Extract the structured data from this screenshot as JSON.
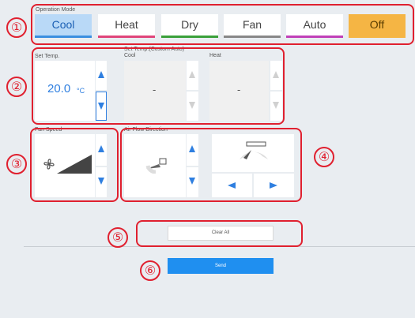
{
  "operation_mode": {
    "label": "Operation Mode",
    "modes": [
      {
        "label": "Cool",
        "underline": "#3b8fe0",
        "selected": true
      },
      {
        "label": "Heat",
        "underline": "#e0457a",
        "selected": false
      },
      {
        "label": "Dry",
        "underline": "#3aa03a",
        "selected": false
      },
      {
        "label": "Fan",
        "underline": "#888888",
        "selected": false
      },
      {
        "label": "Auto",
        "underline": "#c040b8",
        "selected": false
      },
      {
        "label": "Off",
        "underline": "#f5b544",
        "selected": false
      }
    ]
  },
  "set_temp": {
    "label": "Set Temp.",
    "value": "20.0",
    "unit": "°C",
    "custom_auto_label": "Set Temp.(Custom Auto)",
    "cool_label": "Cool",
    "cool_value": "-",
    "heat_label": "Heat",
    "heat_value": "-"
  },
  "fan_speed": {
    "label": "Fan Speed",
    "icon": "fan-icon"
  },
  "air_flow": {
    "label": "Air Flow Direction"
  },
  "actions": {
    "clear_all": "Clear All",
    "send": "Send"
  },
  "callouts": [
    "①",
    "②",
    "③",
    "④",
    "⑤",
    "⑥"
  ],
  "colors": {
    "accent": "#2f7fe0",
    "callout": "#e0202f",
    "off": "#f5b544"
  }
}
